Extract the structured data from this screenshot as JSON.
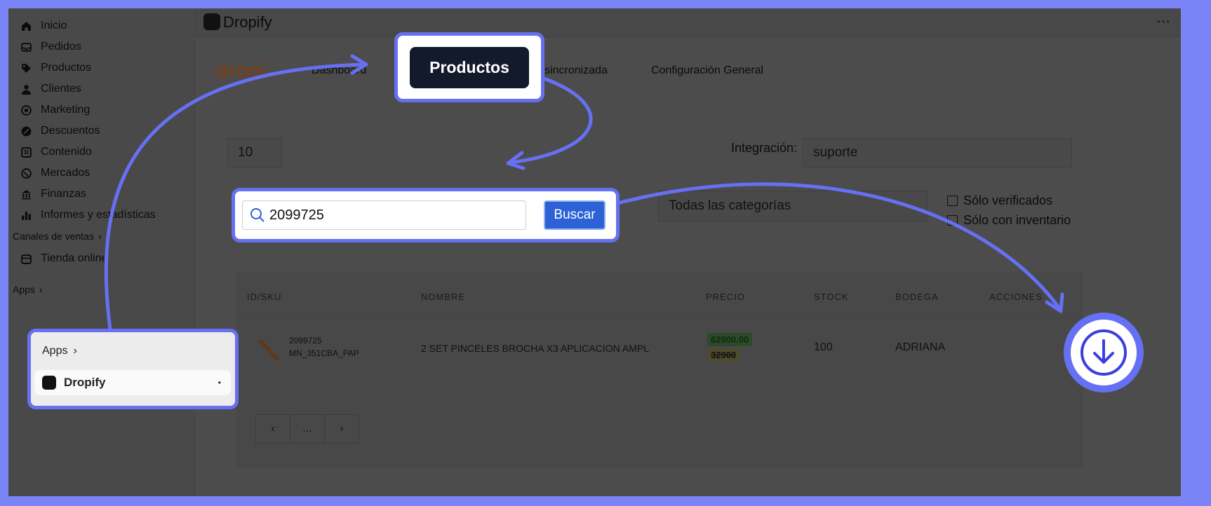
{
  "sidebar": {
    "items": [
      {
        "label": "Inicio",
        "icon": "home-icon"
      },
      {
        "label": "Pedidos",
        "icon": "inbox-icon"
      },
      {
        "label": "Productos",
        "icon": "tag-icon"
      },
      {
        "label": "Clientes",
        "icon": "person-icon"
      },
      {
        "label": "Marketing",
        "icon": "target-icon"
      },
      {
        "label": "Descuentos",
        "icon": "gear-badge-icon"
      },
      {
        "label": "Contenido",
        "icon": "document-icon"
      },
      {
        "label": "Mercados",
        "icon": "globe-icon"
      },
      {
        "label": "Finanzas",
        "icon": "bank-icon"
      },
      {
        "label": "Informes y estadísticas",
        "icon": "bar-chart-icon"
      }
    ],
    "sales_channels_label": "Canales de ventas",
    "online_store_label": "Tienda online",
    "apps_label": "Apps"
  },
  "topbar": {
    "title": "Dropify",
    "more": "⋯"
  },
  "brand": "dropi",
  "tabs": [
    {
      "label": "Dashboard"
    },
    {
      "label": "Productos"
    },
    {
      "label": "Información sincronizada"
    },
    {
      "label": "Configuración General"
    }
  ],
  "filters": {
    "page_size": "10",
    "integration_label": "Integración:",
    "integration_value": "suporte",
    "search_value": "2099725",
    "search_button": "Buscar",
    "category_value": "Todas las categorías",
    "only_verified": "Sólo verificados",
    "only_inventory": "Sólo con inventario"
  },
  "table": {
    "headers": [
      "ID/SKU",
      "NOMBRE",
      "PRECIO",
      "STOCK",
      "BODEGA",
      "ACCIONES"
    ],
    "rows": [
      {
        "id": "2099725",
        "sku": "MN_351CBA_PAP",
        "name": "2 SET PINCELES BROCHA X3 APLICACION AMPL",
        "price": "62900.00",
        "old_price": "32900",
        "stock": "100",
        "warehouse": "ADRIANA"
      }
    ],
    "pagination": {
      "prev": "‹",
      "current": "...",
      "next": "›"
    }
  },
  "callouts": {
    "apps_header": "Apps",
    "apps_item": "Dropify",
    "apps_item_dot": "•",
    "tab_label": "Productos",
    "search_value": "2099725",
    "search_button": "Buscar"
  },
  "colors": {
    "accent": "#6670f3",
    "dark_button": "#131a2b",
    "primary_button": "#2c62d6"
  }
}
